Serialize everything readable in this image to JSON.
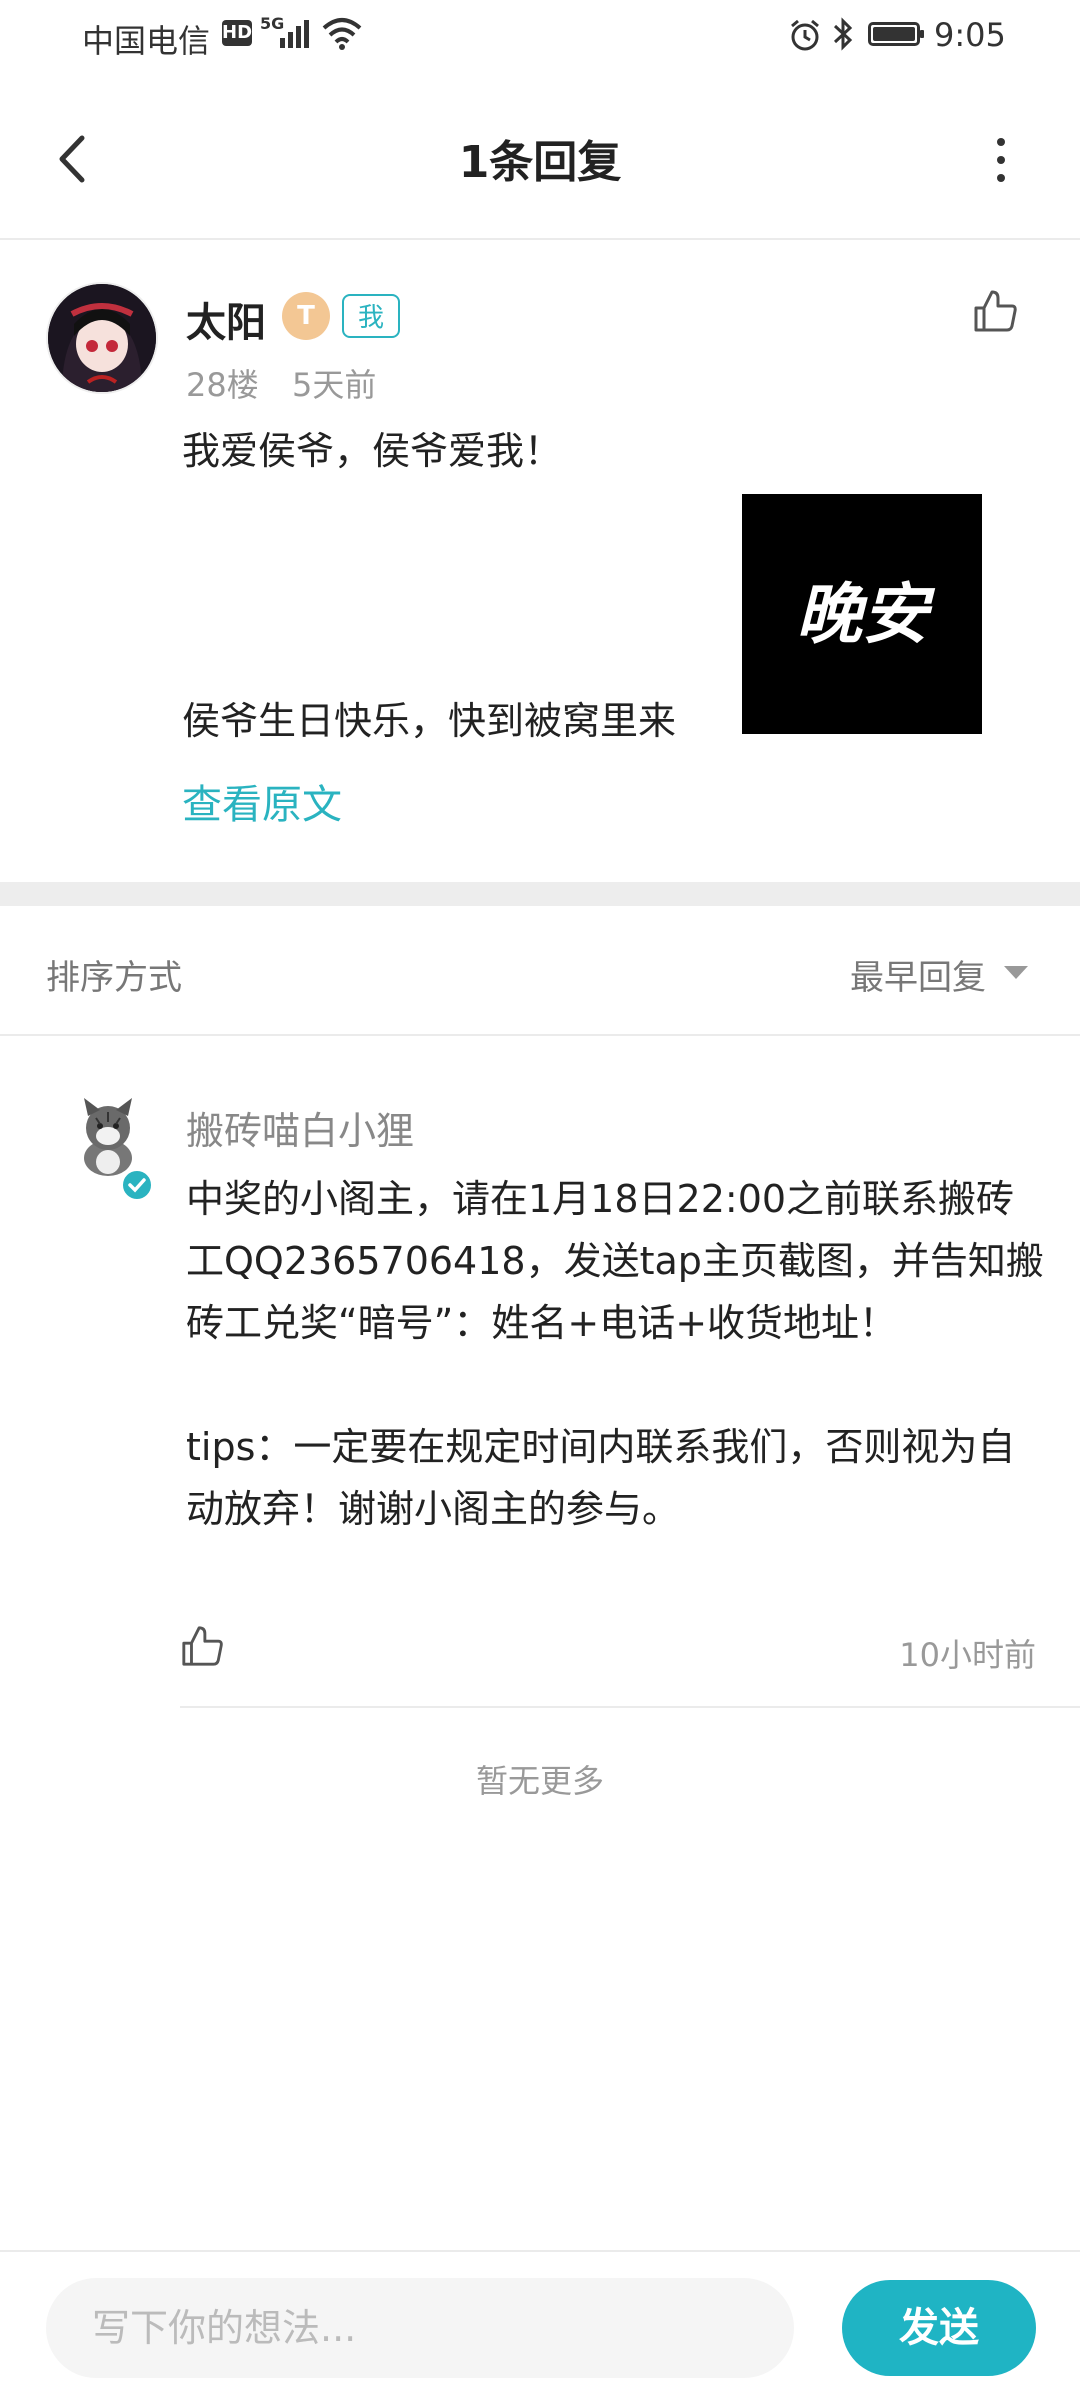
{
  "status_bar": {
    "carrier": "中国电信",
    "hd": "HD",
    "network": "5G",
    "time": "9:05"
  },
  "header": {
    "title": "1条回复"
  },
  "post": {
    "author": "太阳",
    "level_badge": "T",
    "me_badge": "我",
    "floor": "28楼",
    "time": "5天前",
    "text_1": "我爱侯爷，侯爷爱我！",
    "image_text": "晚安",
    "text_2": "侯爷生日快乐，快到被窝里来",
    "view_original": "查看原文"
  },
  "sort": {
    "label": "排序方式",
    "value": "最早回复"
  },
  "reply": {
    "author": "搬砖喵白小狸",
    "text": "中奖的小阁主，请在1月18日22:00之前联系搬砖工QQ2365706418，发送tap主页截图，并告知搬砖工兑奖“暗号”：姓名+电话+收货地址！\n\ntips：一定要在规定时间内联系我们，否则视为自动放弃！谢谢小阁主的参与。",
    "time": "10小时前"
  },
  "footer_note": "暂无更多",
  "bottom_bar": {
    "input_placeholder": "写下你的想法...",
    "send_label": "发送"
  },
  "colors": {
    "accent": "#2ab3c0",
    "send_button": "#1fb4c4",
    "secondary_text": "#999999",
    "divider": "#ededed"
  },
  "icons": [
    "back-arrow-icon",
    "more-vertical-icon",
    "thumbs-up-icon",
    "verified-icon",
    "signal-icon",
    "wifi-icon",
    "alarm-icon",
    "bluetooth-icon",
    "battery-icon"
  ]
}
